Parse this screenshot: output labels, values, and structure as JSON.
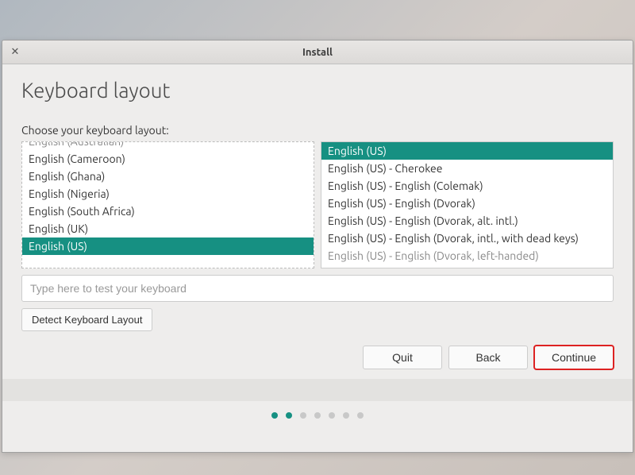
{
  "window": {
    "title": "Install"
  },
  "heading": "Keyboard layout",
  "prompt": "Choose your keyboard layout:",
  "left_list": {
    "items": [
      "English (Australian)",
      "English (Cameroon)",
      "English (Ghana)",
      "English (Nigeria)",
      "English (South Africa)",
      "English (UK)",
      "English (US)"
    ],
    "selected_index": 6
  },
  "right_list": {
    "items": [
      "English (US)",
      "English (US) - Cherokee",
      "English (US) - English (Colemak)",
      "English (US) - English (Dvorak)",
      "English (US) - English (Dvorak, alt. intl.)",
      "English (US) - English (Dvorak, intl., with dead keys)",
      "English (US) - English (Dvorak, left-handed)"
    ],
    "selected_index": 0
  },
  "test_input": {
    "placeholder": "Type here to test your keyboard",
    "value": ""
  },
  "detect_button": "Detect Keyboard Layout",
  "nav": {
    "quit": "Quit",
    "back": "Back",
    "continue": "Continue"
  },
  "progress": {
    "total": 7,
    "active": [
      0,
      1
    ]
  },
  "colors": {
    "accent": "#169082",
    "highlight": "#d22"
  }
}
